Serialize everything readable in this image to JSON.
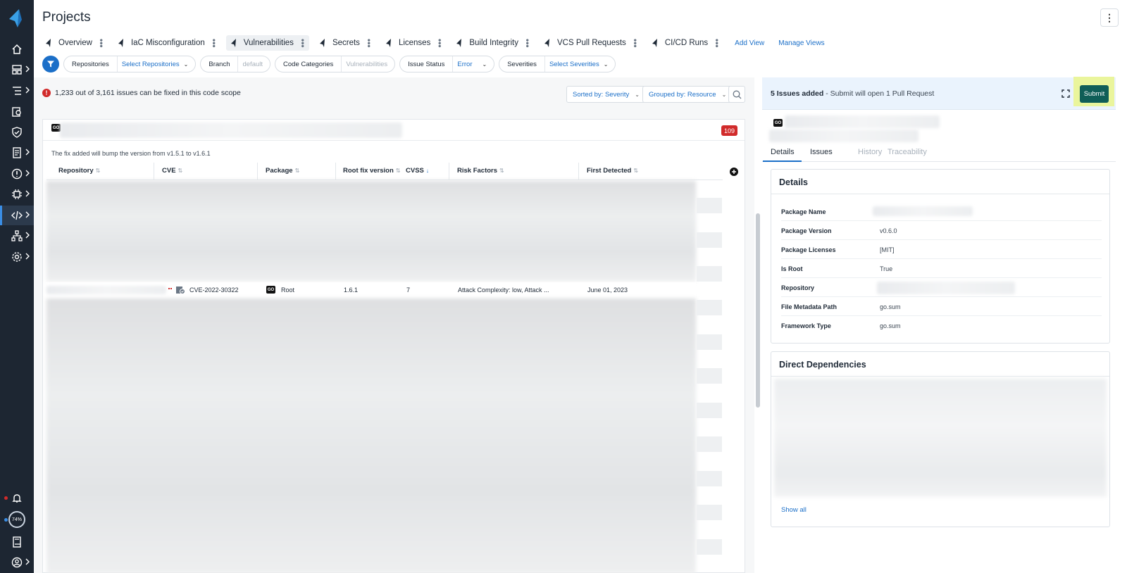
{
  "header": {
    "title": "Projects"
  },
  "tabs": [
    {
      "label": "Overview"
    },
    {
      "label": "IaC Misconfiguration"
    },
    {
      "label": "Vulnerabilities"
    },
    {
      "label": "Secrets"
    },
    {
      "label": "Licenses"
    },
    {
      "label": "Build Integrity"
    },
    {
      "label": "VCS Pull Requests"
    },
    {
      "label": "CI/CD Runs"
    }
  ],
  "tab_links": {
    "add_view": "Add View",
    "manage_views": "Manage Views"
  },
  "filters": [
    {
      "label": "Repositories",
      "value": "Select Repositories",
      "muted": false
    },
    {
      "label": "Branch",
      "value": "default",
      "muted": true
    },
    {
      "label": "Code Categories",
      "value": "Vulnerabilities",
      "muted": true
    },
    {
      "label": "Issue Status",
      "value": "Error",
      "muted": false
    },
    {
      "label": "Severities",
      "value": "Select Severities",
      "muted": false
    }
  ],
  "issues_note": "1,233 out of 3,161 issues can be fixed in this code scope",
  "sort": {
    "sorted_by": "Sorted by: Severity",
    "grouped_by": "Grouped by: Resource"
  },
  "group": {
    "count": "109",
    "bump_note": "The fix added will bump the version from v1.5.1 to v1.6.1"
  },
  "table": {
    "columns": [
      "Repository",
      "CVE",
      "Package",
      "Root fix version",
      "CVSS",
      "Risk Factors",
      "First Detected"
    ],
    "visible_row": {
      "cve": "CVE-2022-30322",
      "package": "Root",
      "root_fix_version": "1.6.1",
      "cvss": "7",
      "risk_factors": "Attack Complexity: low, Attack ...",
      "first_detected": "June 01, 2023"
    }
  },
  "sidebar": {
    "progress_label": "74%"
  },
  "submit_bar": {
    "issues_added": "5 Issues added",
    "rest": " - Submit will open 1 Pull Request",
    "submit_label": "Submit"
  },
  "detail_tabs": [
    {
      "label": "Details",
      "disabled": false
    },
    {
      "label": "Issues",
      "disabled": false
    },
    {
      "label": "History",
      "disabled": true
    },
    {
      "label": "Traceability",
      "disabled": true
    }
  ],
  "details": {
    "title": "Details",
    "rows": [
      {
        "key": "Package Name",
        "value": ""
      },
      {
        "key": "Package Version",
        "value": "v0.6.0"
      },
      {
        "key": "Package Licenses",
        "value": "[MIT]"
      },
      {
        "key": "Is Root",
        "value": "True"
      },
      {
        "key": "Repository",
        "value": ""
      },
      {
        "key": "File Metadata Path",
        "value": "go.sum"
      },
      {
        "key": "Framework Type",
        "value": "go.sum"
      }
    ]
  },
  "direct_dependencies": {
    "title": "Direct Dependencies",
    "show_all": "Show all"
  },
  "colors": {
    "sidebar": "#1d2632",
    "accent": "#1b6fc8",
    "error": "#d12b2b",
    "submit": "#0f5e57",
    "highlight": "#eaf59c"
  }
}
